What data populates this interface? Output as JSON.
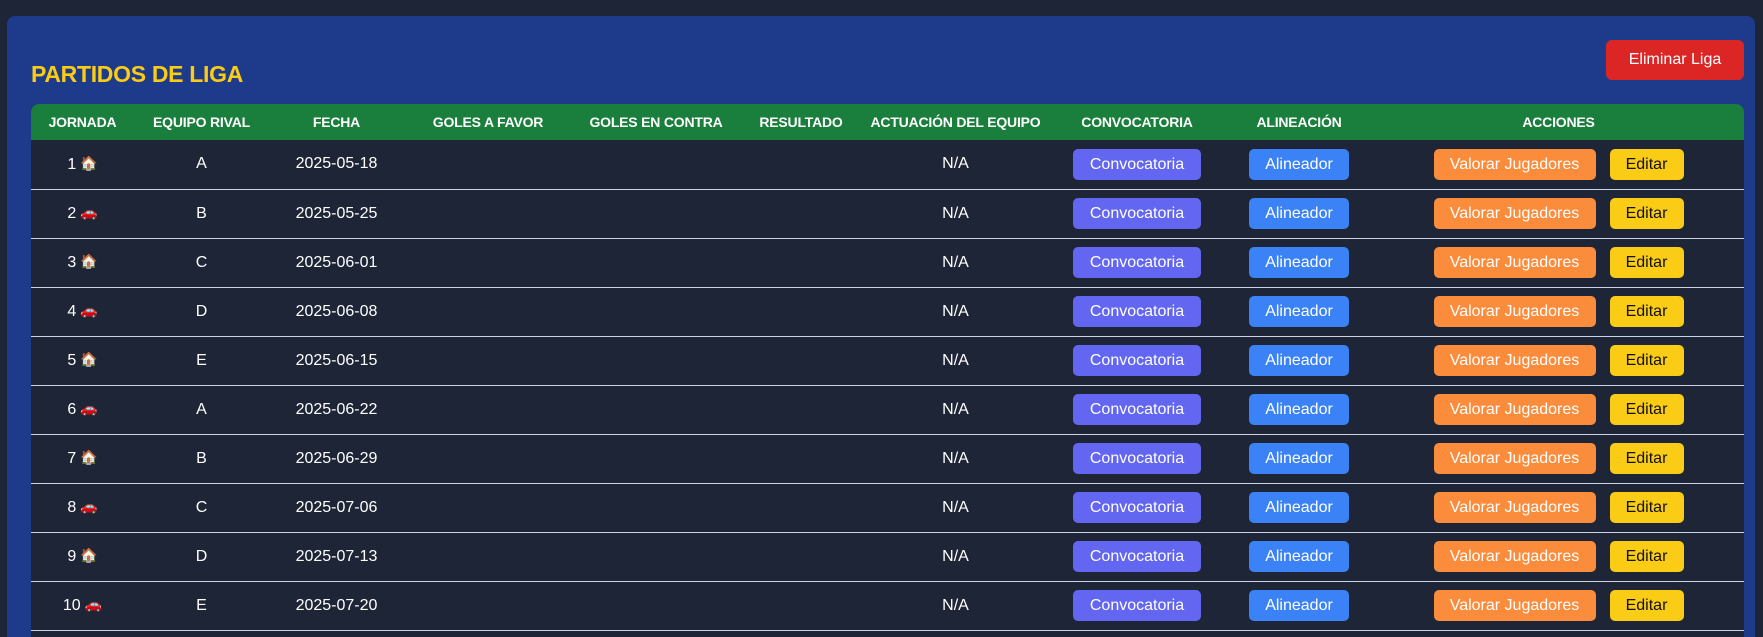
{
  "panel": {
    "title": "PARTIDOS DE LIGA",
    "delete_label": "Eliminar Liga"
  },
  "table": {
    "headers": [
      "JORNADA",
      "EQUIPO RIVAL",
      "FECHA",
      "GOLES A FAVOR",
      "GOLES EN CONTRA",
      "RESULTADO",
      "ACTUACIÓN DEL EQUIPO",
      "CONVOCATORIA",
      "ALINEACIÓN",
      "ACCIONES"
    ],
    "buttons": {
      "convocatoria": "Convocatoria",
      "alineador": "Alineador",
      "valorar": "Valorar Jugadores",
      "editar": "Editar"
    },
    "rows": [
      {
        "jornada": "1",
        "venue_icon": "🏠",
        "venue": "home-icon",
        "rival": "A",
        "fecha": "2025-05-18",
        "goles_favor": "",
        "goles_contra": "",
        "resultado": "",
        "actuacion": "N/A"
      },
      {
        "jornada": "2",
        "venue_icon": "🚗",
        "venue": "car-icon",
        "rival": "B",
        "fecha": "2025-05-25",
        "goles_favor": "",
        "goles_contra": "",
        "resultado": "",
        "actuacion": "N/A"
      },
      {
        "jornada": "3",
        "venue_icon": "🏠",
        "venue": "home-icon",
        "rival": "C",
        "fecha": "2025-06-01",
        "goles_favor": "",
        "goles_contra": "",
        "resultado": "",
        "actuacion": "N/A"
      },
      {
        "jornada": "4",
        "venue_icon": "🚗",
        "venue": "car-icon",
        "rival": "D",
        "fecha": "2025-06-08",
        "goles_favor": "",
        "goles_contra": "",
        "resultado": "",
        "actuacion": "N/A"
      },
      {
        "jornada": "5",
        "venue_icon": "🏠",
        "venue": "home-icon",
        "rival": "E",
        "fecha": "2025-06-15",
        "goles_favor": "",
        "goles_contra": "",
        "resultado": "",
        "actuacion": "N/A"
      },
      {
        "jornada": "6",
        "venue_icon": "🚗",
        "venue": "car-icon",
        "rival": "A",
        "fecha": "2025-06-22",
        "goles_favor": "",
        "goles_contra": "",
        "resultado": "",
        "actuacion": "N/A"
      },
      {
        "jornada": "7",
        "venue_icon": "🏠",
        "venue": "home-icon",
        "rival": "B",
        "fecha": "2025-06-29",
        "goles_favor": "",
        "goles_contra": "",
        "resultado": "",
        "actuacion": "N/A"
      },
      {
        "jornada": "8",
        "venue_icon": "🚗",
        "venue": "car-icon",
        "rival": "C",
        "fecha": "2025-07-06",
        "goles_favor": "",
        "goles_contra": "",
        "resultado": "",
        "actuacion": "N/A"
      },
      {
        "jornada": "9",
        "venue_icon": "🏠",
        "venue": "home-icon",
        "rival": "D",
        "fecha": "2025-07-13",
        "goles_favor": "",
        "goles_contra": "",
        "resultado": "",
        "actuacion": "N/A"
      },
      {
        "jornada": "10",
        "venue_icon": "🚗",
        "venue": "car-icon",
        "rival": "E",
        "fecha": "2025-07-20",
        "goles_favor": "",
        "goles_contra": "",
        "resultado": "",
        "actuacion": "N/A"
      }
    ]
  },
  "colors": {
    "page_background": "#1e2536",
    "panel_background": "#1e3a8a",
    "title": "#facc15",
    "header_row": "#1a7f3c",
    "delete_button": "#dc2626",
    "convocatoria_button": "#6366f1",
    "alineador_button": "#3b82f6",
    "valorar_button": "#fb8c3c",
    "editar_button": "#facc15"
  }
}
